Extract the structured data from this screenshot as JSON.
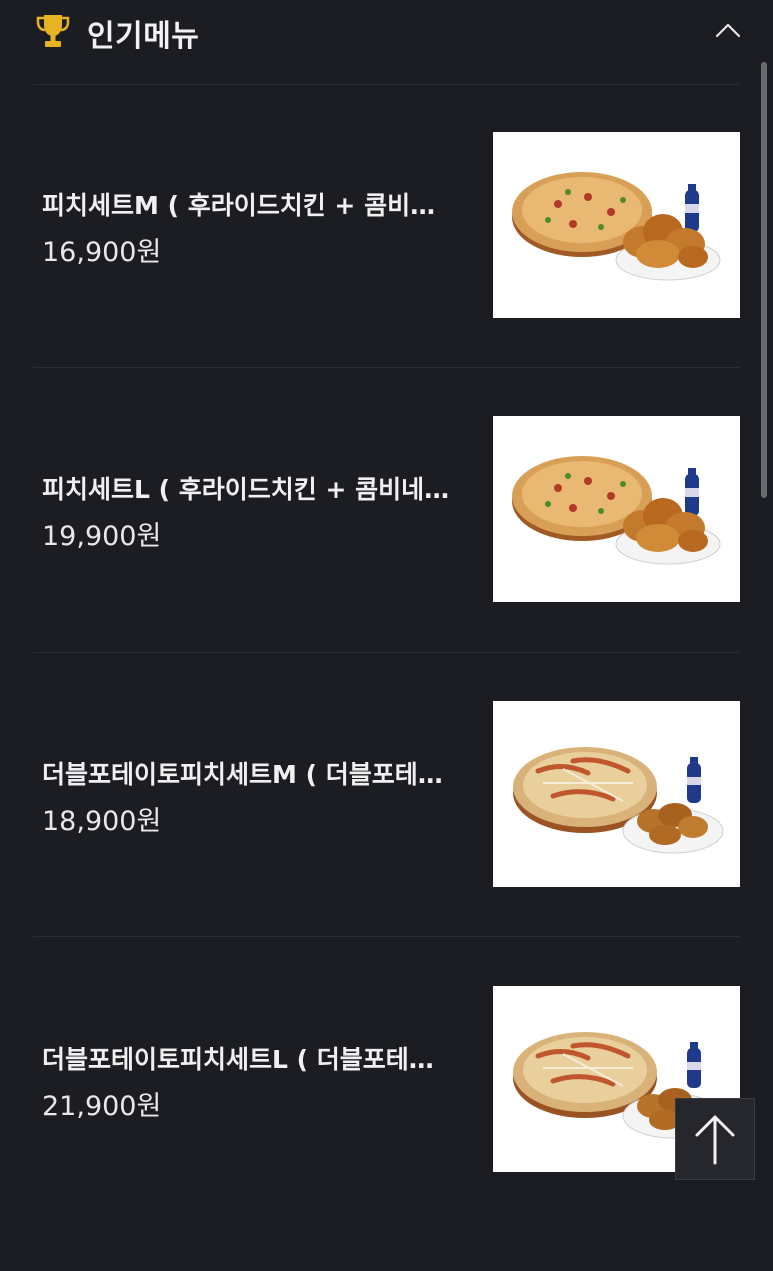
{
  "header": {
    "title": "인기메뉴",
    "trophy_icon": "trophy-icon",
    "collapse_icon": "chevron-up-icon",
    "trophy_color": "#e6b422"
  },
  "menu": {
    "items": [
      {
        "name": "피치세트M ( 후라이드치킨 + 콤비네이션 피자 M )",
        "price": "16,900원",
        "image_icon": "pizza-chicken-set-image"
      },
      {
        "name": "피치세트L ( 후라이드치킨 + 콤비네이션 피자 L )",
        "price": "19,900원",
        "image_icon": "pizza-chicken-set-image"
      },
      {
        "name": "더블포테이토피치세트M ( 더블포테이토 피자 M + 후라이드치킨 )",
        "price": "18,900원",
        "image_icon": "potato-pizza-chicken-set-image"
      },
      {
        "name": "더블포테이토피치세트L ( 더블포테이토 피자 L + 후라이드치킨 )",
        "price": "21,900원",
        "image_icon": "potato-pizza-chicken-set-image"
      }
    ]
  },
  "scroll_top": {
    "icon": "arrow-up-icon"
  }
}
